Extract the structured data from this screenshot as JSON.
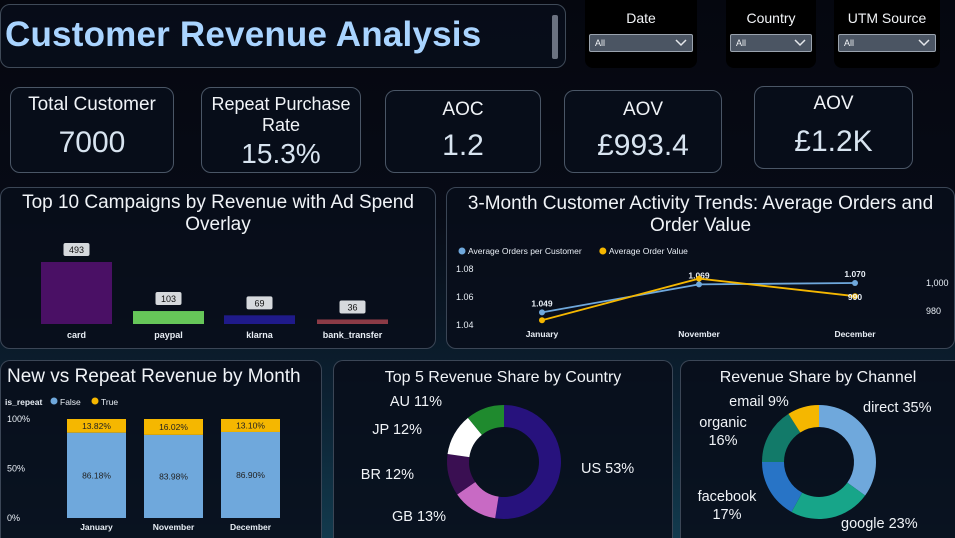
{
  "header": {
    "title": "Customer Revenue Analysis"
  },
  "filters": [
    {
      "label": "Date",
      "value": "All"
    },
    {
      "label": "Country",
      "value": "All"
    },
    {
      "label": "UTM Source",
      "value": "All"
    }
  ],
  "kpis": {
    "total_customer": {
      "label": "Total Customer",
      "value": "7000"
    },
    "repeat_rate": {
      "label": "Repeat Purchase Rate",
      "value": "15.3%"
    },
    "aoc": {
      "label": "AOC",
      "value": "1.2"
    },
    "aov": {
      "label": "AOV",
      "value": "£993.4"
    },
    "aov2": {
      "label": "AOV",
      "value": "£1.2K"
    }
  },
  "chart_data": [
    {
      "id": "campaigns",
      "type": "bar",
      "title": "Top 10 Campaigns by Revenue with Ad Spend Overlay",
      "categories": [
        "card",
        "paypal",
        "klarna",
        "bank_transfer"
      ],
      "values": [
        493,
        103,
        69,
        36
      ],
      "labels": [
        "493",
        "103",
        "69",
        "36"
      ],
      "colors": [
        "#4a1065",
        "#66c659",
        "#1f1a8a",
        "#8c3b46"
      ]
    },
    {
      "id": "activity",
      "type": "line",
      "title": "3-Month Customer Activity Trends: Average Orders and Order Value",
      "categories": [
        "January",
        "November",
        "December"
      ],
      "series": [
        {
          "name": "Average Orders per Customer",
          "color": "#6fa8dc",
          "values": [
            1.049,
            1.069,
            1.07
          ],
          "labels": [
            "1.049",
            "1.069",
            "1.070"
          ]
        },
        {
          "name": "Average Order Value",
          "color": "#f5b700",
          "values": [
            978,
            1004,
            993
          ],
          "labels": [
            "",
            "",
            "990"
          ]
        }
      ],
      "y_ticks": [
        "1.08",
        "1.06",
        "1.04"
      ],
      "y2_ticks": [
        "1,000",
        "980"
      ],
      "ylim": [
        1.04,
        1.08
      ],
      "y2lim": [
        975,
        1010
      ]
    },
    {
      "id": "new_vs_repeat",
      "type": "bar",
      "title": "New vs Repeat Revenue by Month",
      "legend_title": "is_repeat",
      "categories": [
        "January",
        "November",
        "December"
      ],
      "series": [
        {
          "name": "False",
          "color": "#6fa8dc",
          "values": [
            86.18,
            83.98,
            86.9
          ],
          "labels": [
            "86.18%",
            "83.98%",
            "86.90%"
          ]
        },
        {
          "name": "True",
          "color": "#f5b700",
          "values": [
            13.82,
            16.02,
            13.1
          ],
          "labels": [
            "13.82%",
            "16.02%",
            "13.10%"
          ]
        }
      ],
      "y_ticks": [
        "100%",
        "50%",
        "0%"
      ],
      "ylim": [
        0,
        100
      ]
    },
    {
      "id": "country",
      "type": "pie",
      "title": "Top 5 Revenue Share by Country",
      "slices": [
        {
          "name": "US",
          "value": 53,
          "label": "US 53%",
          "color": "#27127d"
        },
        {
          "name": "GB",
          "value": 13,
          "label": "GB 13%",
          "color": "#c86ac4"
        },
        {
          "name": "BR",
          "value": 12,
          "label": "BR 12%",
          "color": "#3a0f52"
        },
        {
          "name": "JP",
          "value": 12,
          "label": "JP 12%",
          "color": "#ffffff"
        },
        {
          "name": "AU",
          "value": 11,
          "label": "AU 11%",
          "color": "#1f8a2e"
        }
      ]
    },
    {
      "id": "channel",
      "type": "pie",
      "title": "Revenue Share by Channel",
      "slices": [
        {
          "name": "direct",
          "value": 35,
          "label": "direct 35%",
          "color": "#6fa8dc"
        },
        {
          "name": "google",
          "value": 23,
          "label": "google 23%",
          "color": "#17a589"
        },
        {
          "name": "facebook",
          "value": 17,
          "label": [
            "facebook",
            "17%"
          ],
          "color": "#2874c6"
        },
        {
          "name": "organic",
          "value": 16,
          "label": [
            "organic",
            "16%"
          ],
          "color": "#127a69"
        },
        {
          "name": "email",
          "value": 9,
          "label": "email 9%",
          "color": "#f5b700"
        }
      ]
    }
  ]
}
